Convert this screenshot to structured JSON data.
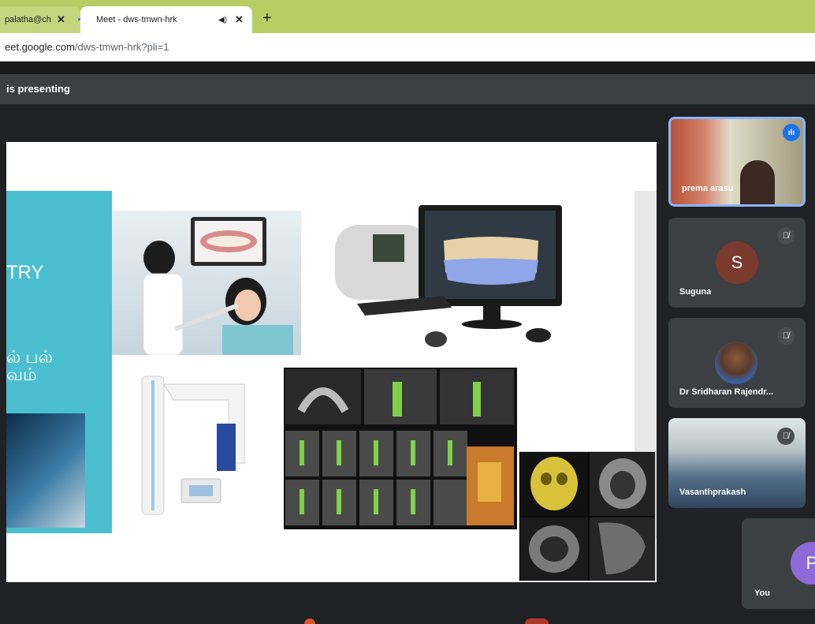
{
  "browser": {
    "tabs": [
      {
        "title": "palatha@ch",
        "active": false
      },
      {
        "title": "Meet - dws-tmwn-hrk",
        "active": true
      }
    ],
    "close_glyph": "✕",
    "audio_glyph": "◀)",
    "new_tab_glyph": "+",
    "address": {
      "host": "eet.google.com",
      "path": "/dws-tmwn-hrk?pli=1"
    }
  },
  "meet": {
    "banner_text": "is presenting",
    "slide": {
      "partial_text_1": "TRY",
      "partial_text_2": "ல் பல்",
      "partial_text_3": "வம்",
      "image_names": [
        "dentist-patient-photo",
        "intraoral-scanner-photo",
        "cbct-machine-photo",
        "dental-scan-grid",
        "skull-ct-views"
      ]
    },
    "participants": [
      {
        "name": "prema arasu",
        "speaking": true,
        "muted": false,
        "video": true
      },
      {
        "name": "Suguna",
        "initial": "S",
        "muted": true,
        "video": false,
        "avatar_color": "#7a3a2d"
      },
      {
        "name": "Dr Sridharan Rajendr...",
        "muted": true,
        "video": false
      },
      {
        "name": "Vasanthprakash",
        "muted": true,
        "video": true
      }
    ],
    "self": {
      "name": "You",
      "initial": "P",
      "avatar_color": "#8e6ad8"
    },
    "speaking_glyph": "ılı",
    "mic_off_glyph": "🎙̸",
    "colors": {
      "accent": "#1a73e8",
      "tile_bg": "#3c4043",
      "meet_bg": "#202124",
      "tabstrip": "#b7cc62"
    }
  }
}
